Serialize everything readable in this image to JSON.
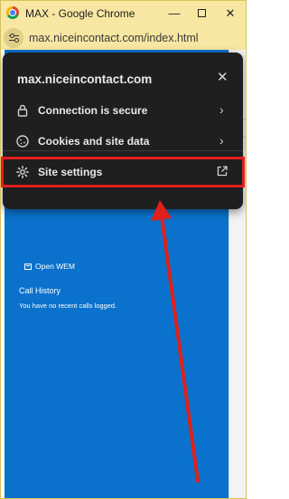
{
  "window": {
    "title": "MAX - Google Chrome",
    "minimize_glyph": "—",
    "close_glyph": "✕"
  },
  "address_bar": {
    "url": "max.niceincontact.com/index.html"
  },
  "page": {
    "open_wem": "Open WEM",
    "call_history_title": "Call History",
    "call_history_empty": "You have no recent calls logged."
  },
  "site_popup": {
    "host": "max.niceincontact.com",
    "close_glyph": "✕",
    "items": [
      {
        "label": "Connection is secure",
        "icon": "lock-icon",
        "trailing": "›"
      },
      {
        "label": "Cookies and site data",
        "icon": "cookie-icon",
        "trailing": "›"
      },
      {
        "label": "Site settings",
        "icon": "gear-icon",
        "trailing": "external-link-icon"
      }
    ]
  },
  "annotation": {
    "highlight_color": "#e0201b",
    "arrow_color": "#e0201b"
  }
}
